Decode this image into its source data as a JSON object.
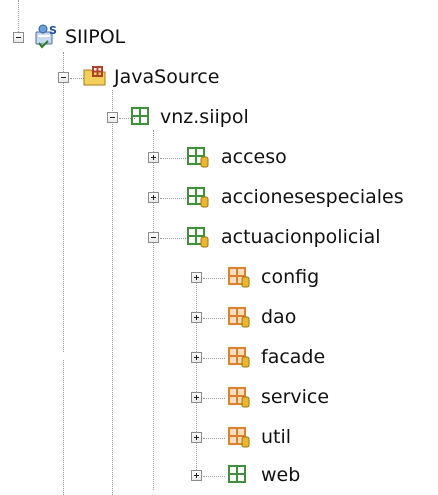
{
  "tree": {
    "project": {
      "label": "SIIPOL",
      "icon": "java-project-icon",
      "expanded": true
    },
    "source_folder": {
      "label": "JavaSource",
      "icon": "source-folder-icon",
      "expanded": true
    },
    "root_package": {
      "label": "vnz.siipol",
      "icon": "package-icon",
      "expanded": true
    },
    "packages": [
      {
        "label": "acceso",
        "icon": "package-icon",
        "expanded": false
      },
      {
        "label": "accionesespeciales",
        "icon": "package-icon",
        "expanded": false
      },
      {
        "label": "actuacionpolicial",
        "icon": "package-icon",
        "expanded": true
      }
    ],
    "sub_packages": [
      {
        "label": "config",
        "icon": "package-icon",
        "expanded": false
      },
      {
        "label": "dao",
        "icon": "package-icon",
        "expanded": false
      },
      {
        "label": "facade",
        "icon": "package-icon",
        "expanded": false
      },
      {
        "label": "service",
        "icon": "package-icon",
        "expanded": false
      },
      {
        "label": "util",
        "icon": "package-icon",
        "expanded": false
      },
      {
        "label": "web",
        "icon": "package-icon",
        "expanded": false
      }
    ]
  },
  "colors": {
    "package_green": "#3f8f3f",
    "package_orange": "#d9822b",
    "jar_yellow": "#e8b830",
    "folder_yellow": "#f4cf5a"
  }
}
